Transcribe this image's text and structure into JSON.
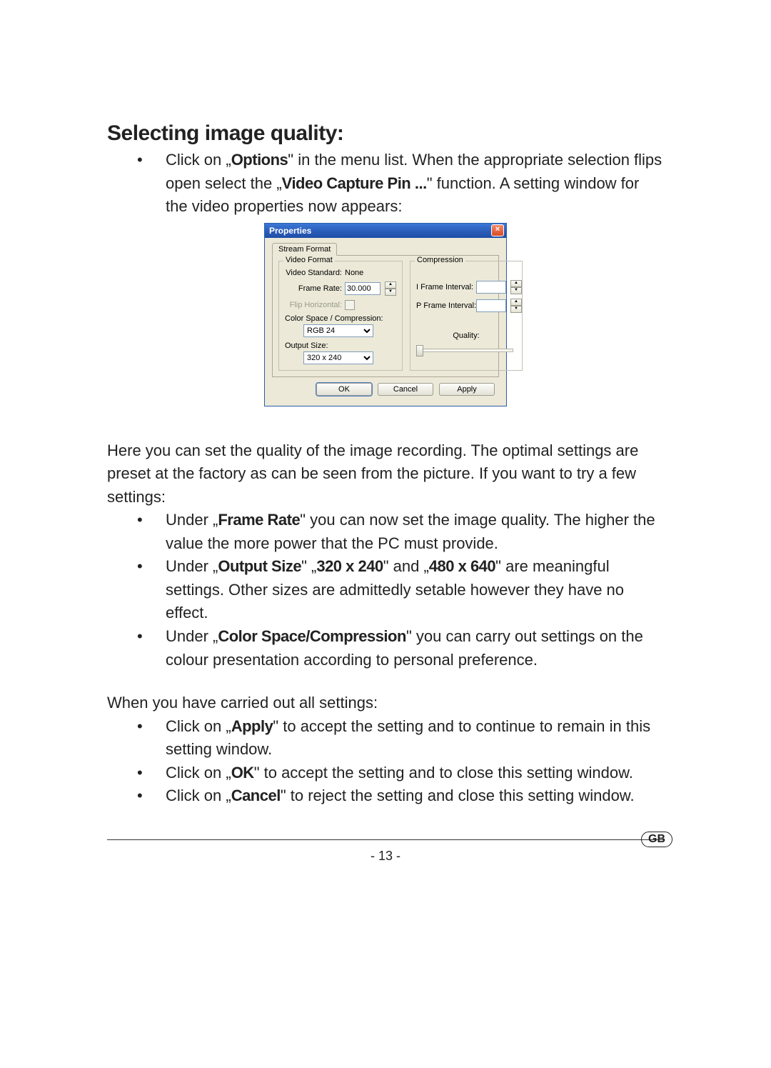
{
  "heading": "Selecting image quality:",
  "intro_parts": {
    "a": "Click on „",
    "b": "Options",
    "c": "\" in the menu list. When the appropriate selection flips open select the  „",
    "d": "Video Capture Pin ...",
    "e": "\" function. A setting window for the video properties now appears:"
  },
  "dialog": {
    "title": "Properties",
    "close": "×",
    "tab": "Stream Format",
    "video_format_legend": "Video Format",
    "compression_legend": "Compression",
    "labels": {
      "video_standard": "Video Standard:",
      "video_standard_value": "None",
      "frame_rate": "Frame Rate:",
      "frame_rate_value": "30.000",
      "flip_horizontal": "Flip Horizontal:",
      "color_space": "Color Space / Compression:",
      "color_space_value": "RGB 24",
      "output_size": "Output Size:",
      "output_size_value": "320 x 240",
      "i_frame": "I Frame Interval:",
      "p_frame": "P Frame Interval:",
      "quality": "Quality:"
    },
    "buttons": {
      "ok": "OK",
      "cancel": "Cancel",
      "apply": "Apply"
    }
  },
  "after_dialog": "Here you can set the quality of the image recording. The optimal settings are preset at the factory as can be seen from the picture. If you want to try a few settings:",
  "settings_list": [
    {
      "pre": "Under „",
      "b": "Frame Rate",
      "post": "\" you can now set the image quality. The higher the value the more power that the PC must provide."
    },
    {
      "pre": "Under „",
      "b": "Output Size",
      "mid1": "\" „",
      "b2": "320 x 240",
      "mid2": "\" and „",
      "b3": "480 x 640",
      "post": "\" are meaningful settings. Other sizes are admittedly setable however they have no effect."
    },
    {
      "pre": "Under „",
      "b": "Color Space/Compression",
      "post": "\" you can carry out settings on the colour presentation according to personal preference."
    }
  ],
  "when_done": "When you have carried out all settings:",
  "final_list": [
    {
      "pre": "Click on „",
      "b": "Apply",
      "post": "\" to accept the setting and to continue to remain in this setting window."
    },
    {
      "pre": "Click on „",
      "b": "OK",
      "post": "\" to accept the setting and to close this setting window."
    },
    {
      "pre": "Click on „",
      "b": "Cancel",
      "post": "\" to reject the setting and close this setting window."
    }
  ],
  "page_number": "- 13 -",
  "gb": "GB"
}
